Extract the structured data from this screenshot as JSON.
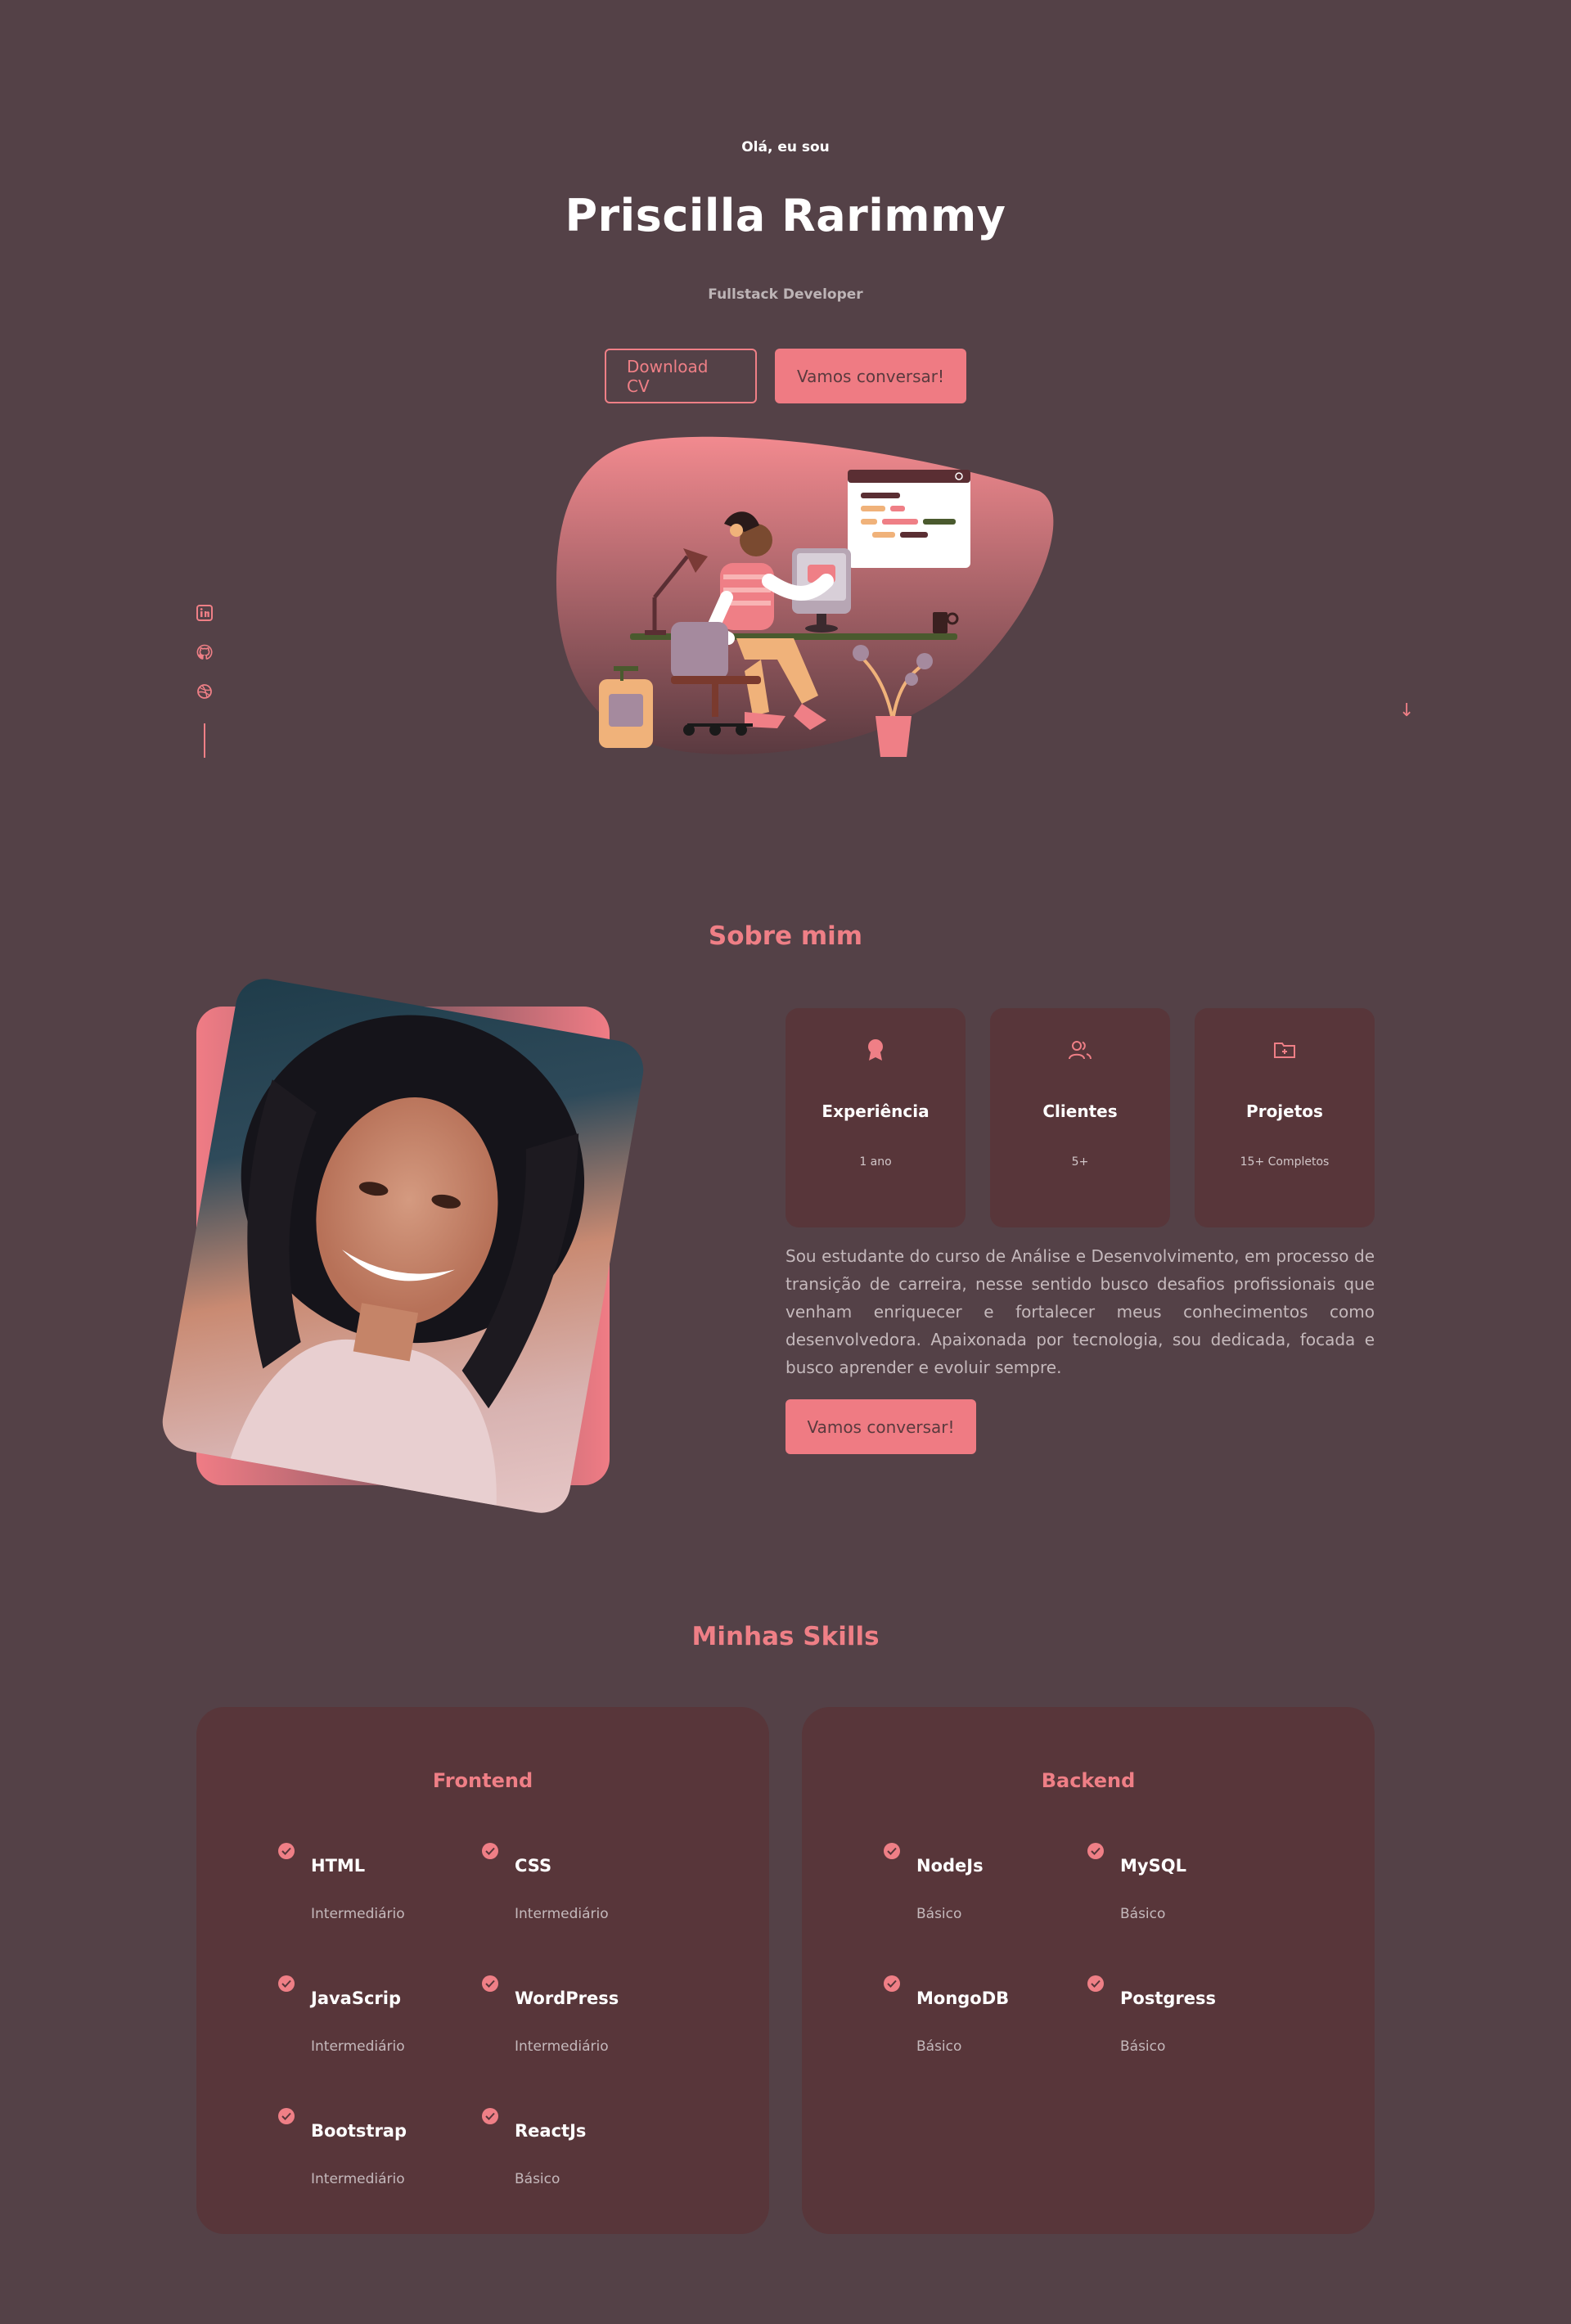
{
  "hero": {
    "greeting": "Olá, eu sou",
    "name": "Priscilla Rarimmy",
    "role": "Fullstack Developer",
    "download_cv": "Download CV",
    "contact_button": "Vamos conversar!",
    "scroll_icon": "↓"
  },
  "social": [
    {
      "icon": "linkedin-icon"
    },
    {
      "icon": "github-icon"
    },
    {
      "icon": "dribbble-icon"
    }
  ],
  "about": {
    "title": "Sobre mim",
    "cards": [
      {
        "icon": "award-icon",
        "title": "Experiência",
        "value": "1 ano"
      },
      {
        "icon": "users-icon",
        "title": "Clientes",
        "value": "5+"
      },
      {
        "icon": "folder-icon",
        "title": "Projetos",
        "value": "15+ Completos"
      }
    ],
    "text": "Sou estudante do curso de Análise e Desenvolvimento, em processo de transição de carreira, nesse sentido busco desafios profissionais que venham enriquecer e fortalecer meus conhecimentos como desenvolvedora. Apaixonada por tecnologia, sou dedicada, focada e busco aprender e evoluir sempre.",
    "button": "Vamos conversar!"
  },
  "skills": {
    "title": "Minhas Skills",
    "frontend": {
      "title": "Frontend",
      "items": [
        {
          "name": "HTML",
          "level": "Intermediário"
        },
        {
          "name": "CSS",
          "level": "Intermediário"
        },
        {
          "name": "JavaScrip",
          "level": "Intermediário"
        },
        {
          "name": "WordPress",
          "level": "Intermediário"
        },
        {
          "name": "Bootstrap",
          "level": "Intermediário"
        },
        {
          "name": "ReactJs",
          "level": "Básico"
        }
      ]
    },
    "backend": {
      "title": "Backend",
      "items": [
        {
          "name": "NodeJs",
          "level": "Básico"
        },
        {
          "name": "MySQL",
          "level": "Básico"
        },
        {
          "name": "MongoDB",
          "level": "Básico"
        },
        {
          "name": "Postgress",
          "level": "Básico"
        }
      ]
    }
  },
  "colors": {
    "background": "#544147",
    "accent": "#ef7f86",
    "card": "#58363a"
  }
}
